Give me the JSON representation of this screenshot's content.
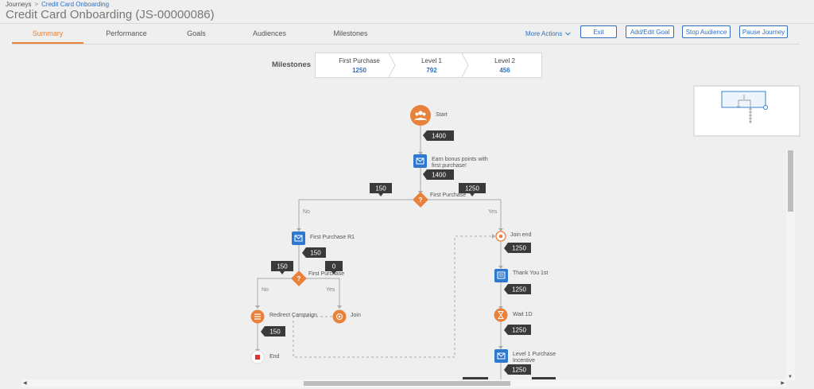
{
  "breadcrumb": {
    "root": "Journeys",
    "separator": ">",
    "current": "Credit Card Onboarding"
  },
  "title": "Credit Card Onboarding (JS-00000086)",
  "tabs": [
    {
      "label": "Summary",
      "active": true
    },
    {
      "label": "Performance",
      "active": false
    },
    {
      "label": "Goals",
      "active": false
    },
    {
      "label": "Audiences",
      "active": false
    },
    {
      "label": "Milestones",
      "active": false
    }
  ],
  "actions": {
    "more_actions": "More Actions",
    "exit": "Exit",
    "add_edit_goal": "Add/Edit Goal",
    "stop_audience": "Stop Audience",
    "pause_journey": "Pause Journey"
  },
  "milestones": {
    "label": "Milestones",
    "steps": [
      {
        "name": "First Purchase",
        "value": "1250"
      },
      {
        "name": "Level 1",
        "value": "792"
      },
      {
        "name": "Level 2",
        "value": "456"
      }
    ]
  },
  "colors": {
    "accent": "#e8813a",
    "brand_blue": "#2f6fc0",
    "node_blue": "#2f78d0",
    "count_badge": "#3a3a3a"
  },
  "flow": {
    "nodes": {
      "start": {
        "label": "Start",
        "icon": "audience-icon"
      },
      "earn_bonus": {
        "label": "Earn bonus points with first purchase!",
        "icon": "email-icon"
      },
      "decision_1": {
        "label": "First Purchase",
        "icon": "question-icon"
      },
      "first_purchase_r1": {
        "label": "First Purchase R1",
        "icon": "email-icon"
      },
      "decision_2": {
        "label": "First Purchase",
        "icon": "question-icon"
      },
      "redirect_campaign": {
        "label": "Redirect Campaign",
        "icon": "list-icon"
      },
      "join": {
        "label": "Join",
        "icon": "join-icon"
      },
      "end": {
        "label": "End",
        "icon": "stop-icon"
      },
      "join_end": {
        "label": "Join end",
        "icon": "join-icon"
      },
      "thank_you": {
        "label": "Thank You 1st",
        "icon": "message-icon"
      },
      "wait": {
        "label": "Wait 1D",
        "icon": "hourglass-icon"
      },
      "level1_incentive": {
        "label": "Level 1 Purchase Incentive",
        "icon": "email-icon"
      }
    },
    "counts": {
      "start": "1400",
      "earn_bonus": "1400",
      "branch_no": "150",
      "branch_yes": "1250",
      "r1": "150",
      "d2_no": "150",
      "d2_yes": "0",
      "redirect": "150",
      "join_end": "1250",
      "thank_you": "1250",
      "wait": "1250",
      "level1": "1250"
    },
    "branches": {
      "no": "No",
      "yes": "Yes",
      "no2": "No",
      "yes2": "Yes"
    }
  }
}
